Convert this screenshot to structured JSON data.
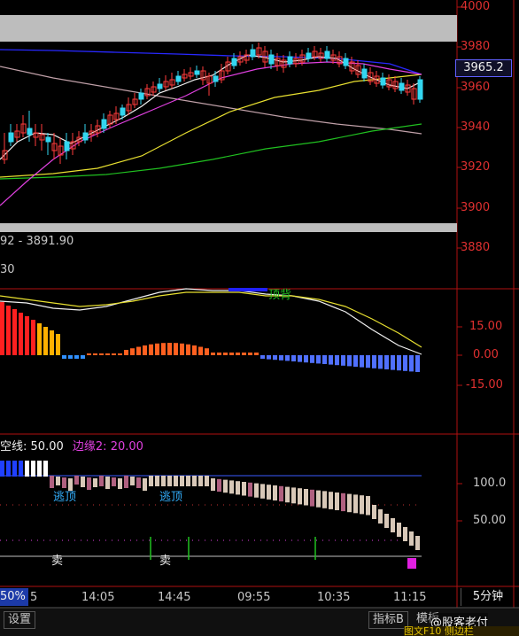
{
  "price_axis": {
    "labels": [
      "4000",
      "3980",
      "3960",
      "3940",
      "3920",
      "3900",
      "3880"
    ],
    "current_price": "3965.2",
    "range_text": "92 - 3891.90",
    "extra_text": "30"
  },
  "macd_axis": {
    "labels": [
      "15.00",
      "0.00",
      "-15.00"
    ],
    "signal_label": "顶背"
  },
  "lower_indicator": {
    "line_label_1": "空线:",
    "line_value_1": "50.00",
    "line_label_2": "边缘2:",
    "line_value_2": "20.00",
    "axis_labels": [
      "100.0",
      "50.00"
    ],
    "signals_top": [
      "逃顶",
      "逃顶"
    ],
    "signals_sell": [
      "卖",
      "卖"
    ]
  },
  "time_axis": {
    "left_partial": "50%",
    "left_partial_2": "5",
    "labels": [
      "14:05",
      "14:45",
      "09:55",
      "10:35",
      "11:15"
    ],
    "period": "5分钟"
  },
  "bottom_bar": {
    "settings_label": "设置",
    "indicator_label": "指标B",
    "template_label": "模板",
    "watermark": "@股客老付",
    "ticker_partial": "图文F10 侧边栏"
  },
  "colors": {
    "up": "#ff3b3b",
    "down": "#33d6f0",
    "ma_white": "#f0f0f0",
    "ma_yellow": "#e8e030",
    "ma_magenta": "#e040e0",
    "ma_green": "#20c020",
    "ma_blue": "#2020ff",
    "ma_gray": "#c0a0a0"
  }
}
